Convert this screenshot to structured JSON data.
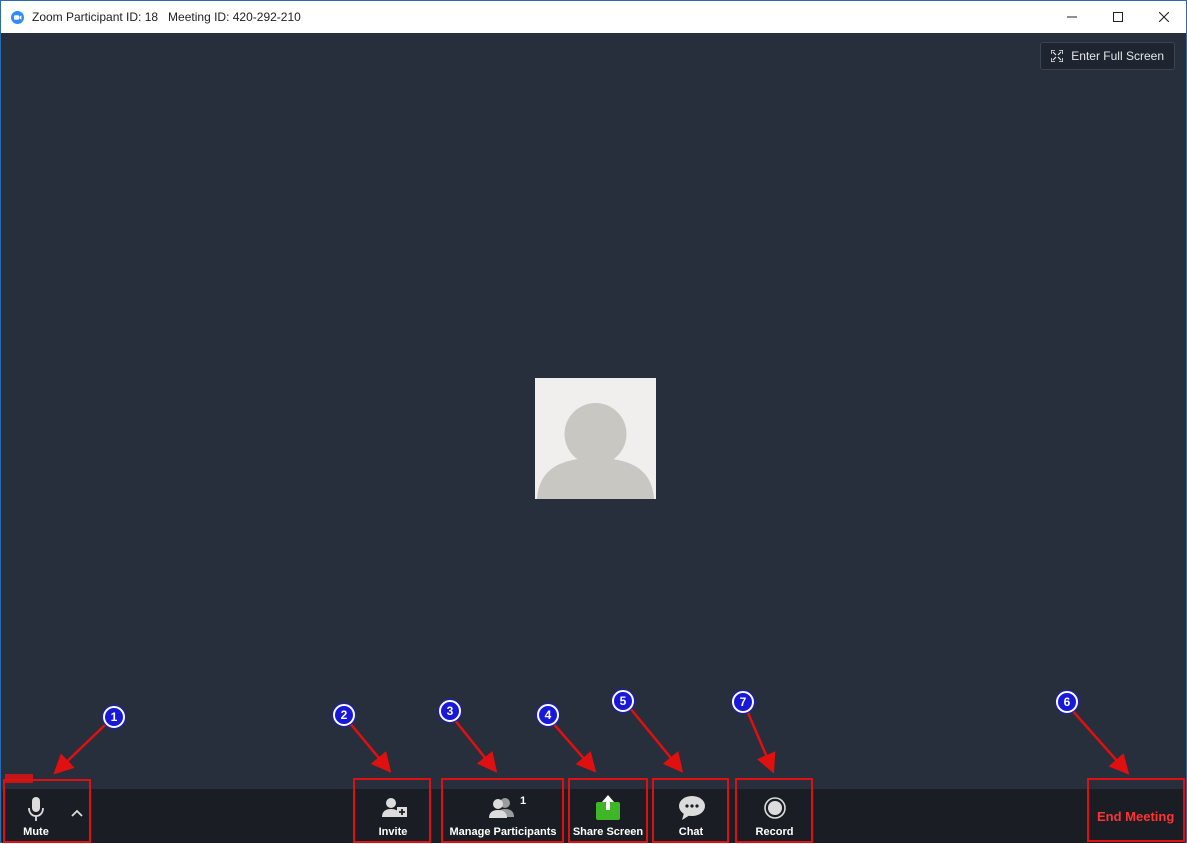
{
  "window": {
    "title": "Zoom Participant ID: 18   Meeting ID: 420-292-210"
  },
  "stage": {
    "fullscreen_label": "Enter Full Screen"
  },
  "toolbar": {
    "mute_label": "Mute",
    "invite_label": "Invite",
    "participants_label": "Manage Participants",
    "participants_count": "1",
    "share_label": "Share Screen",
    "chat_label": "Chat",
    "record_label": "Record",
    "end_label": "End Meeting"
  },
  "annotations": {
    "markers": [
      "1",
      "2",
      "3",
      "4",
      "5",
      "7",
      "6"
    ],
    "box_color": "#e01010",
    "marker_color": "#1818d8"
  },
  "colors": {
    "stage_bg": "#262f3b",
    "toolbar_bg": "#1a1e24",
    "share_green": "#3fb627",
    "end_red": "#ff3333"
  }
}
